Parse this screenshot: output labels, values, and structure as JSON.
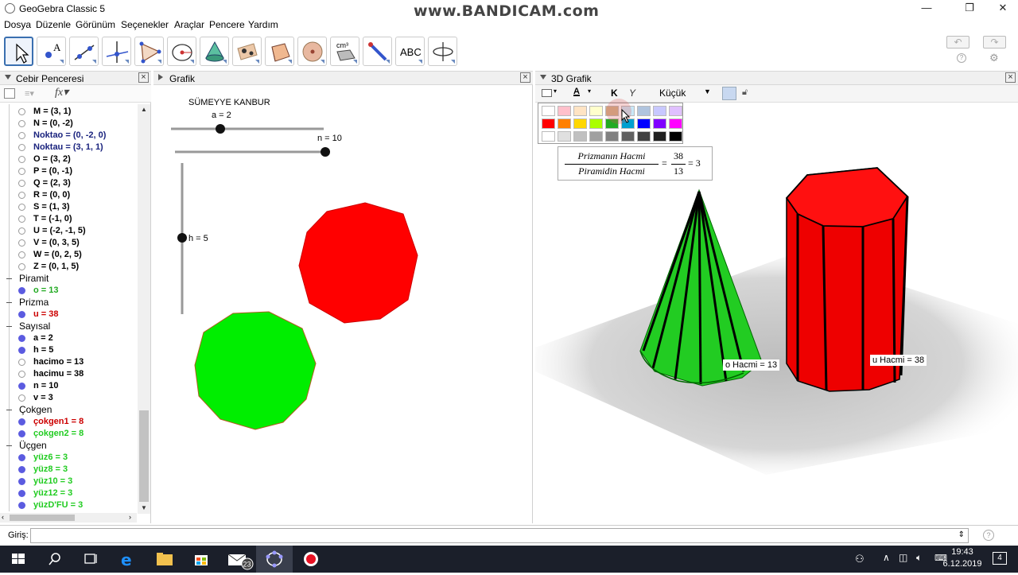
{
  "window": {
    "title": "GeoGebra Classic 5",
    "watermark": "www.BANDICAM.com",
    "controls": [
      "—",
      "❐",
      "✕"
    ]
  },
  "menu": [
    "Dosya",
    "Düzenle",
    "Görünüm",
    "Seçenekler",
    "Araçlar",
    "Pencere",
    "Yardım"
  ],
  "toolbar": {
    "tools": [
      "move",
      "point",
      "line",
      "perpendicular",
      "polygon",
      "circle",
      "cone",
      "reflect",
      "pyramid",
      "sphere",
      "volume",
      "net",
      "text",
      "rotate-view"
    ],
    "text_tool_label": "ABC",
    "volume_tool_label": "cm³",
    "undo": "↶",
    "redo": "↷"
  },
  "algebra": {
    "title": "Cebir Penceresi",
    "rows": [
      {
        "t": "M = (3, 1)",
        "vis": false,
        "c": "#000000"
      },
      {
        "t": "N = (0, -2)",
        "vis": false,
        "c": "#000000"
      },
      {
        "t": "Noktao = (0, -2, 0)",
        "vis": false,
        "c": "#1a237e"
      },
      {
        "t": "Noktau = (3, 1, 1)",
        "vis": false,
        "c": "#1a237e"
      },
      {
        "t": "O = (3, 2)",
        "vis": false,
        "c": "#000000"
      },
      {
        "t": "P = (0, -1)",
        "vis": false,
        "c": "#000000"
      },
      {
        "t": "Q = (2, 3)",
        "vis": false,
        "c": "#000000"
      },
      {
        "t": "R = (0, 0)",
        "vis": false,
        "c": "#000000"
      },
      {
        "t": "S = (1, 3)",
        "vis": false,
        "c": "#000000"
      },
      {
        "t": "T = (-1, 0)",
        "vis": false,
        "c": "#000000"
      },
      {
        "t": "U = (-2, -1, 5)",
        "vis": false,
        "c": "#000000"
      },
      {
        "t": "V = (0, 3, 5)",
        "vis": false,
        "c": "#000000"
      },
      {
        "t": "W = (0, 2, 5)",
        "vis": false,
        "c": "#000000"
      },
      {
        "t": "Z = (0, 1, 5)",
        "vis": false,
        "c": "#000000"
      },
      {
        "group": "Piramit"
      },
      {
        "t": "o = 13",
        "vis": true,
        "c": "#22aa22"
      },
      {
        "group": "Prizma"
      },
      {
        "t": "u = 38",
        "vis": true,
        "c": "#cc0000"
      },
      {
        "group": "Sayısal"
      },
      {
        "t": "a = 2",
        "vis": true,
        "c": "#000000"
      },
      {
        "t": "h = 5",
        "vis": true,
        "c": "#000000"
      },
      {
        "t": "hacimo = 13",
        "vis": false,
        "c": "#000000"
      },
      {
        "t": "hacimu = 38",
        "vis": false,
        "c": "#000000"
      },
      {
        "t": "n = 10",
        "vis": true,
        "c": "#000000"
      },
      {
        "t": "v = 3",
        "vis": false,
        "c": "#000000"
      },
      {
        "group": "Çokgen"
      },
      {
        "t": "çokgen1 = 8",
        "vis": true,
        "c": "#cc0000"
      },
      {
        "t": "çokgen2 = 8",
        "vis": true,
        "c": "#22cc22"
      },
      {
        "group": "Üçgen"
      },
      {
        "t": "yüz6 = 3",
        "vis": true,
        "c": "#22cc22"
      },
      {
        "t": "yüz8 = 3",
        "vis": true,
        "c": "#22cc22"
      },
      {
        "t": "yüz10 = 3",
        "vis": true,
        "c": "#22cc22"
      },
      {
        "t": "yüz12 = 3",
        "vis": true,
        "c": "#22cc22"
      },
      {
        "t": "yüzD'FU = 3",
        "vis": true,
        "c": "#22cc22"
      }
    ]
  },
  "graphics": {
    "title": "Grafik",
    "author": "SÜMEYYE KANBUR",
    "sliders": {
      "a": {
        "label": "a = 2",
        "value": 2
      },
      "n": {
        "label": "n = 10",
        "value": 10
      },
      "h": {
        "label": "h = 5",
        "value": 5
      }
    },
    "red_polygon_color": "#ff0000",
    "green_polygon_color": "#00ee00"
  },
  "graphics3d": {
    "title": "3D Grafik",
    "style_bar": {
      "bold": "K",
      "italic": "Y",
      "size": "Küçük"
    },
    "formula": {
      "num_label": "Prizmanın Hacmi",
      "den_label": "Piramidin Hacmi",
      "num_value": "38",
      "den_value": "13",
      "result": "= 3",
      "eq": "="
    },
    "label_pyramid": "o Hacmi = 13",
    "label_prism": "u Hacmi = 38",
    "palette": [
      [
        "#ffffff",
        "#ffc0cb",
        "#ffe4c4",
        "#ffffcc",
        "#d2b48c",
        "#c8e8f8",
        "#b0c4de",
        "#c8c8ff",
        "#e0c0ff"
      ],
      [
        "#ff0000",
        "#ff8000",
        "#ffd700",
        "#aaff00",
        "#22aa22",
        "#00a0d0",
        "#0000ff",
        "#8000ff",
        "#ff00ff"
      ],
      [
        "#ffffff",
        "#e0e0e0",
        "#c0c0c0",
        "#a0a0a0",
        "#808080",
        "#606060",
        "#404040",
        "#202020",
        "#000000"
      ]
    ]
  },
  "input": {
    "label": "Giriş:",
    "placeholder": ""
  },
  "taskbar": {
    "time": "19:43",
    "date": "6.12.2019",
    "notif_count": "4",
    "mail_badge": "23",
    "apps": [
      "windows",
      "search",
      "task-view",
      "edge",
      "explorer",
      "store",
      "mail",
      "geogebra",
      "recorder"
    ]
  }
}
